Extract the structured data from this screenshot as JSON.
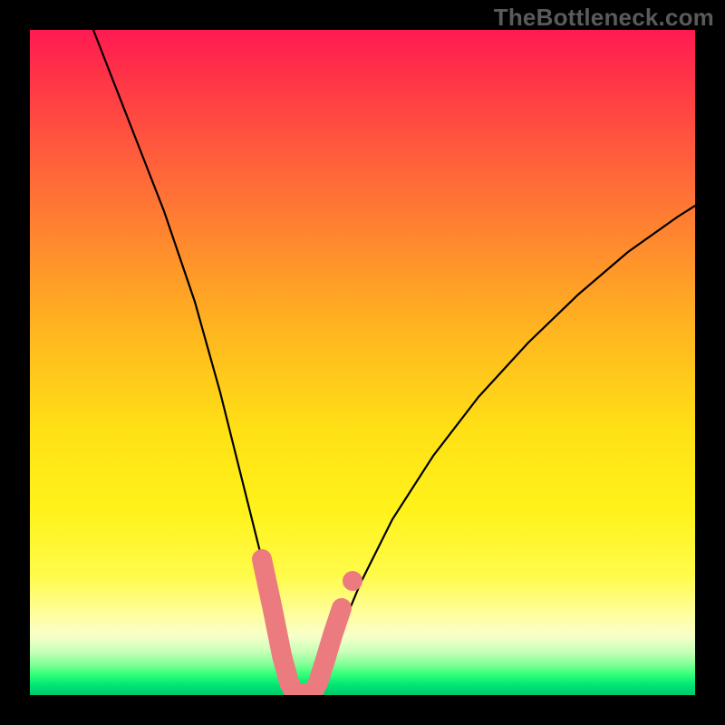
{
  "watermark": "TheBottleneck.com",
  "colors": {
    "pink_overlay": "#ec7b80",
    "curve": "#000000"
  },
  "chart_data": {
    "type": "line",
    "title": "",
    "xlabel": "",
    "ylabel": "",
    "xlim": [
      0,
      734
    ],
    "ylim_svg": [
      0,
      734
    ],
    "note": "Two black curves forming a V/funnel shape over a vertical heat gradient (red=high bottleneck at top, green=low at bottom). Pink rounded segments highlight the lowest (best) region of each curve near the trough.",
    "series": [
      {
        "name": "left-curve",
        "points_svg": [
          [
            70,
            0
          ],
          [
            109,
            100
          ],
          [
            148,
            200
          ],
          [
            182,
            300
          ],
          [
            210,
            400
          ],
          [
            235,
            500
          ],
          [
            255,
            580
          ],
          [
            268,
            640
          ],
          [
            278,
            690
          ],
          [
            286,
            720
          ],
          [
            292,
            732
          ]
        ]
      },
      {
        "name": "right-curve",
        "points_svg": [
          [
            316,
            732
          ],
          [
            324,
            715
          ],
          [
            340,
            670
          ],
          [
            365,
            610
          ],
          [
            400,
            540
          ],
          [
            445,
            470
          ],
          [
            495,
            405
          ],
          [
            550,
            345
          ],
          [
            605,
            292
          ],
          [
            660,
            245
          ],
          [
            715,
            206
          ],
          [
            734,
            194
          ]
        ]
      }
    ],
    "pink_highlights": {
      "left_segment_svg": [
        [
          256,
          584
        ],
        [
          268,
          640
        ],
        [
          278,
          690
        ],
        [
          286,
          720
        ],
        [
          292,
          732
        ]
      ],
      "right_segment_svg": [
        [
          300,
          732
        ],
        [
          312,
          732
        ],
        [
          318,
          720
        ],
        [
          326,
          695
        ],
        [
          334,
          668
        ],
        [
          344,
          638
        ]
      ],
      "extra_dot_svg": [
        356,
        608
      ]
    }
  }
}
